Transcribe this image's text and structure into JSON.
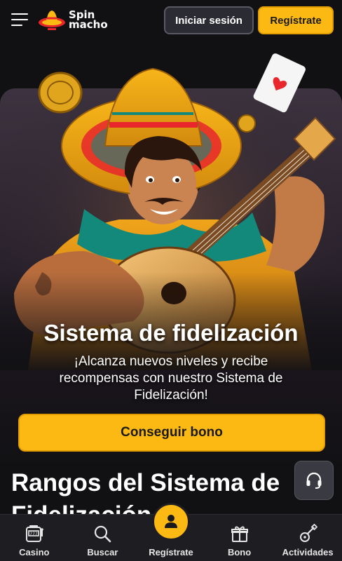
{
  "header": {
    "menu_icon": "hamburger-menu-icon",
    "logo_line1": "Spin",
    "logo_line2": "macho",
    "login_label": "Iniciar sesión",
    "register_label": "Regístrate"
  },
  "hero": {
    "title": "Sistema de fidelización",
    "subtitle": "¡Alcanza nuevos niveles y recibe recompensas con nuestro Sistema de Fidelización!",
    "cta_label": "Conseguir bono"
  },
  "section": {
    "title": "Rangos del Sistema de Fidelización"
  },
  "support": {
    "icon": "headset-icon"
  },
  "bottom_nav": [
    {
      "label": "Casino",
      "icon": "slot-machine-icon"
    },
    {
      "label": "Buscar",
      "icon": "search-icon"
    },
    {
      "label": "Regístrate",
      "icon": "user-plus-icon"
    },
    {
      "label": "Bono",
      "icon": "gift-icon"
    },
    {
      "label": "Actividades",
      "icon": "guitar-icon"
    }
  ],
  "colors": {
    "accent": "#fdb913",
    "background": "#111114",
    "nav_background": "#1d1d22"
  }
}
